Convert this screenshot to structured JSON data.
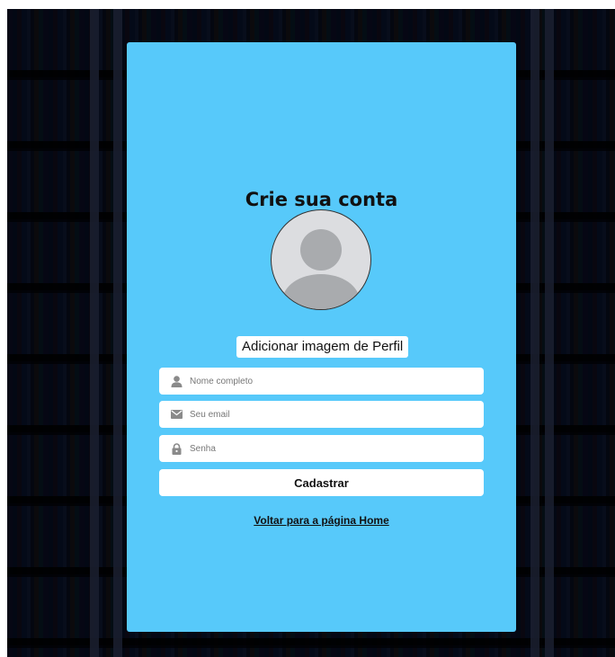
{
  "page": {
    "title": "Crie sua conta",
    "add_image_label": "Adicionar imagem de Perfil",
    "back_link_label": "Voltar para a página Home"
  },
  "form": {
    "name": {
      "placeholder": "Nome completo",
      "value": "",
      "icon": "user-icon"
    },
    "email": {
      "placeholder": "Seu email",
      "value": "",
      "icon": "envelope-icon"
    },
    "password": {
      "placeholder": "Senha",
      "value": "",
      "icon": "lock-icon"
    },
    "submit_label": "Cadastrar"
  },
  "colors": {
    "card": "#57c9fa",
    "field": "#ffffff",
    "icon": "#8a8a8a",
    "text": "#111111"
  }
}
